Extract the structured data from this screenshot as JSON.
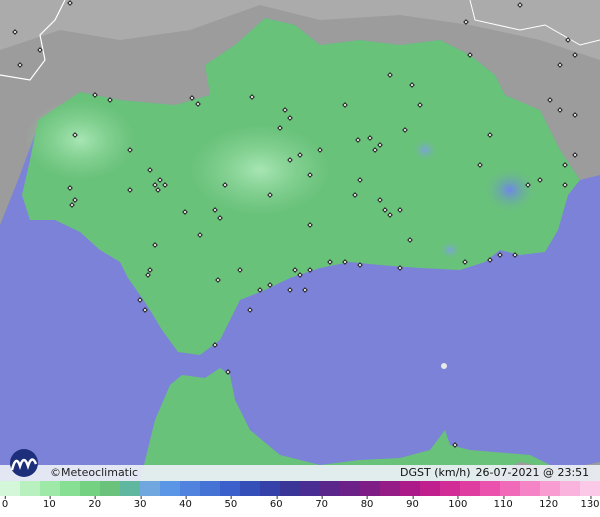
{
  "map": {
    "region": "Andalucía",
    "sea_color": "#7b82d8",
    "land_color": "#69c27a",
    "terrain_color": "#9c9c9c"
  },
  "footer": {
    "brand": "©Meteoclimatic",
    "metric": "DGST (km/h)",
    "datetime": "26-07-2021 @ 23:51 UTC"
  },
  "legend": {
    "ticks": [
      "0",
      "10",
      "20",
      "30",
      "40",
      "50",
      "60",
      "70",
      "80",
      "90",
      "100",
      "110",
      "120",
      "130"
    ],
    "colors": [
      "#d3f7d8",
      "#b9f0c0",
      "#9ee8a8",
      "#86df92",
      "#74d181",
      "#6bc27a",
      "#5fb7a0",
      "#6fa7de",
      "#5a95e6",
      "#4f83de",
      "#4572d5",
      "#3b5fcb",
      "#344fb8",
      "#3540a8",
      "#3a3698",
      "#4a2d92",
      "#5a268c",
      "#6c2188",
      "#7f1d86",
      "#951b86",
      "#ab1a88",
      "#c01f8e",
      "#d22c96",
      "#e03da0",
      "#eb52ad",
      "#f16ab9",
      "#f584c6",
      "#f89cd2",
      "#fab3dd",
      "#fbc8e7"
    ]
  }
}
